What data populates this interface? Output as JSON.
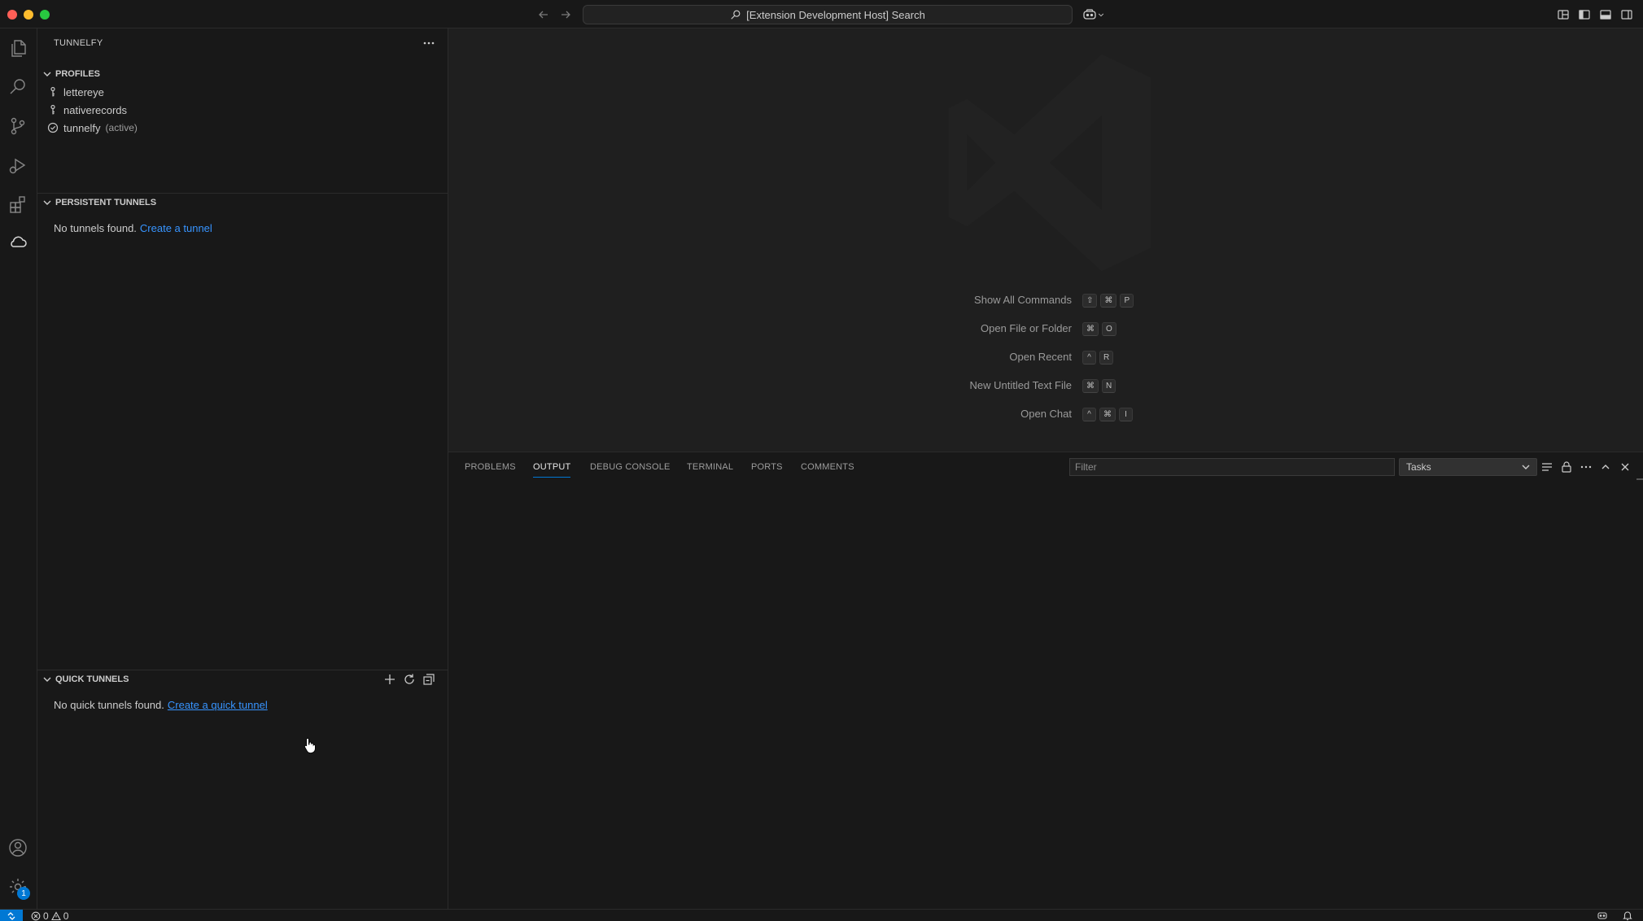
{
  "titlebar": {
    "search_text": "[Extension Development Host] Search"
  },
  "sidebar": {
    "title": "TUNNELFY",
    "profiles": {
      "header": "PROFILES",
      "items": [
        {
          "label": "lettereye",
          "description": "",
          "icon": "key-icon"
        },
        {
          "label": "nativerecords",
          "description": "",
          "icon": "key-icon"
        },
        {
          "label": "tunnelfy",
          "description": "(active)",
          "icon": "check-circle-icon"
        }
      ]
    },
    "persistent_tunnels": {
      "header": "PERSISTENT TUNNELS",
      "empty_text": "No tunnels found.",
      "link_text": "Create a tunnel"
    },
    "quick_tunnels": {
      "header": "QUICK TUNNELS",
      "empty_text": "No quick tunnels found.",
      "link_text": "Create a quick tunnel"
    }
  },
  "editor": {
    "shortcuts": [
      {
        "label": "Show All Commands",
        "keys": [
          "⇧",
          "⌘",
          "P"
        ]
      },
      {
        "label": "Open File or Folder",
        "keys": [
          "⌘",
          "O"
        ]
      },
      {
        "label": "Open Recent",
        "keys": [
          "^",
          "R"
        ]
      },
      {
        "label": "New Untitled Text File",
        "keys": [
          "⌘",
          "N"
        ]
      },
      {
        "label": "Open Chat",
        "keys": [
          "^",
          "⌘",
          "I"
        ]
      }
    ]
  },
  "panel": {
    "tabs": [
      {
        "label": "PROBLEMS",
        "active": false
      },
      {
        "label": "OUTPUT",
        "active": true
      },
      {
        "label": "DEBUG CONSOLE",
        "active": false
      },
      {
        "label": "TERMINAL",
        "active": false
      },
      {
        "label": "PORTS",
        "active": false
      },
      {
        "label": "COMMENTS",
        "active": false
      }
    ],
    "filter_placeholder": "Filter",
    "output_channel": "Tasks"
  },
  "statusbar": {
    "errors": "0",
    "warnings": "0"
  },
  "activitybar": {
    "settings_badge": "1"
  },
  "colors": {
    "accent": "#0078d4",
    "link": "#3794ff",
    "background": "#181818",
    "editor_background": "#1f1f1f"
  }
}
